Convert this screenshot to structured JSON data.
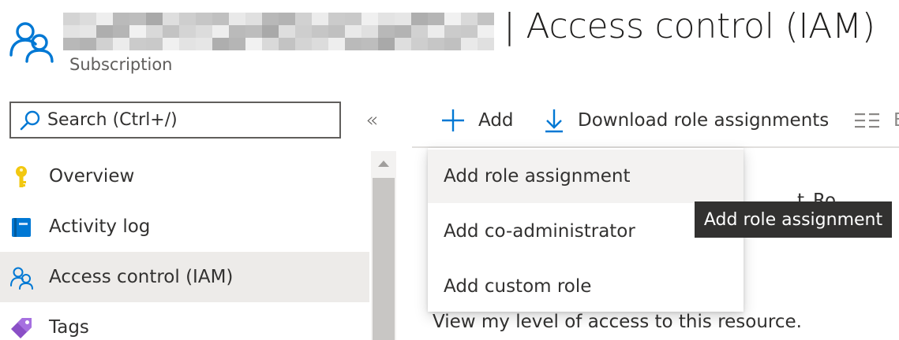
{
  "header": {
    "title": "| Access control (IAM)",
    "subtitle": "Subscription",
    "redacted_swatches": [
      "#d4d4d4",
      "#ececec",
      "#bdbdbd",
      "#e3e3e3",
      "#c6c6c6",
      "#f1f1f1",
      "#b8b8b8",
      "#dcdcdc",
      "#cbcbcb",
      "#a9a9a9",
      "#e6e6e6",
      "#c0c0c0",
      "#d9d9d9",
      "#b3b3b3",
      "#eeeeee",
      "#c9c9c9",
      "#dedede",
      "#aeaeae",
      "#e9e9e9",
      "#c3c3c3",
      "#d1d1d1",
      "#bababa",
      "#f0f0f0",
      "#cecece",
      "#b5b5b5",
      "#e0e0e0"
    ]
  },
  "sidebar": {
    "search_placeholder": "Search (Ctrl+/)",
    "collapse_glyph": "«",
    "items": [
      {
        "label": "Overview",
        "icon": "key-icon"
      },
      {
        "label": "Activity log",
        "icon": "book-icon"
      },
      {
        "label": "Access control (IAM)",
        "icon": "people-icon",
        "active": true
      },
      {
        "label": "Tags",
        "icon": "tag-icon"
      }
    ]
  },
  "toolbar": {
    "add_label": "Add",
    "download_label": "Download role assignments",
    "columns_label": "E"
  },
  "content": {
    "partial_heading": "Ro",
    "partial_line": "t",
    "view_access_text": "View my level of access to this resource."
  },
  "dropdown": {
    "items": [
      {
        "label": "Add role assignment",
        "hovered": true
      },
      {
        "label": "Add co-administrator"
      },
      {
        "label": "Add custom role"
      }
    ]
  },
  "tooltip": {
    "text": "Add role assignment"
  },
  "colors": {
    "accent": "#0078d4",
    "key": "#f2c811",
    "tag": "#8a4fc6",
    "tooltip_bg": "#323130"
  }
}
